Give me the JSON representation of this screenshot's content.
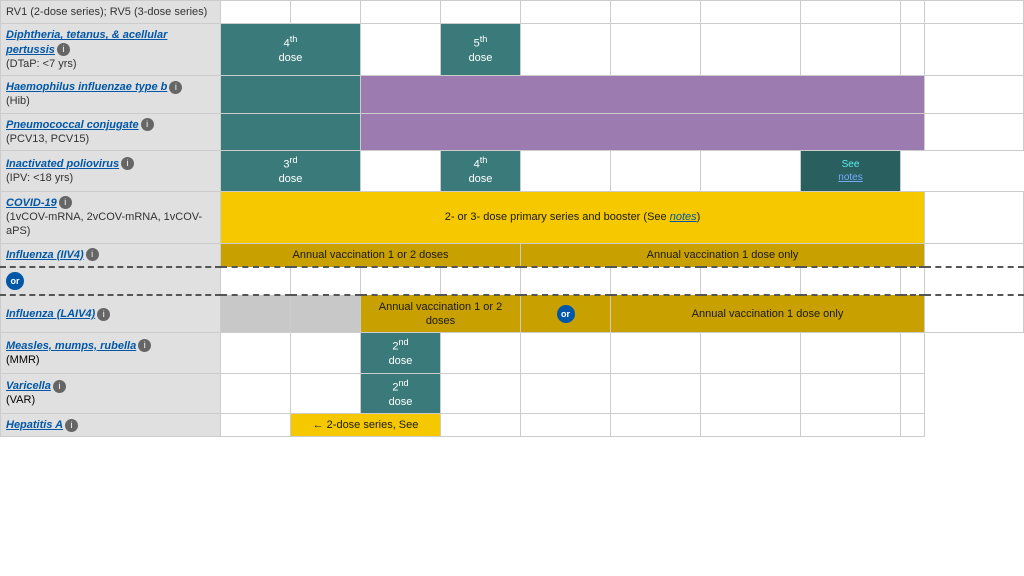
{
  "rows": [
    {
      "id": "rv",
      "name_text": "RV1 (2-dose series); RV5 (3-dose series)",
      "name_link": null,
      "sub": null,
      "cells": [
        {
          "span": 1,
          "class": "gray-light",
          "text": ""
        },
        {
          "span": 1,
          "class": "gray-light",
          "text": ""
        },
        {
          "span": 1,
          "class": "gray-light",
          "text": ""
        },
        {
          "span": 1,
          "class": "",
          "text": ""
        },
        {
          "span": 1,
          "class": "",
          "text": ""
        },
        {
          "span": 1,
          "class": "",
          "text": ""
        },
        {
          "span": 1,
          "class": "",
          "text": ""
        },
        {
          "span": 1,
          "class": "",
          "text": ""
        },
        {
          "span": 1,
          "class": "",
          "text": ""
        }
      ]
    },
    {
      "id": "dtap",
      "name_text": "Diphtheria, tetanus, & acellular pertussis",
      "name_link": true,
      "sub": "(DTaP: <7 yrs)",
      "info": true,
      "cells": [
        {
          "span": 2,
          "class": "teal-dark",
          "text": "←4th dose→",
          "text_color": "white"
        },
        {
          "span": 1,
          "class": "",
          "text": ""
        },
        {
          "span": 1,
          "class": "teal-dark dose-box",
          "text": "5th dose",
          "text_color": "white"
        },
        {
          "span": 1,
          "class": "",
          "text": ""
        },
        {
          "span": 1,
          "class": "",
          "text": ""
        },
        {
          "span": 1,
          "class": "",
          "text": ""
        },
        {
          "span": 1,
          "class": "",
          "text": ""
        },
        {
          "span": 1,
          "class": "",
          "text": ""
        }
      ]
    },
    {
      "id": "hib",
      "name_text": "Haemophilus influenzae type b",
      "name_link": true,
      "sub": "(Hib)",
      "info": true,
      "cells": [
        {
          "span": 2,
          "class": "teal-dark",
          "text": ""
        },
        {
          "span": 6,
          "class": "purple",
          "text": ""
        }
      ]
    },
    {
      "id": "pcv",
      "name_text": "Pneumococcal conjugate",
      "name_link": true,
      "sub": "(PCV13, PCV15)",
      "info": true,
      "cells": [
        {
          "span": 2,
          "class": "teal-dark",
          "text": ""
        },
        {
          "span": 6,
          "class": "purple",
          "text": ""
        }
      ]
    },
    {
      "id": "ipv",
      "name_text": "Inactivated poliovirus",
      "name_link": true,
      "sub": "(IPV: <18 yrs)",
      "info": true,
      "cells": [
        {
          "span": 2,
          "class": "teal-dark",
          "text": "←3rd dose→",
          "text_color": "white"
        },
        {
          "span": 1,
          "class": "",
          "text": ""
        },
        {
          "span": 1,
          "class": "teal-dark dose-box",
          "text": "4th dose",
          "text_color": "white"
        },
        {
          "span": 1,
          "class": "",
          "text": ""
        },
        {
          "span": 1,
          "class": "",
          "text": ""
        },
        {
          "span": 1,
          "class": "",
          "text": ""
        },
        {
          "span": 1,
          "class": "dark-teal",
          "text": "See notes",
          "text_color": "teal-link"
        }
      ]
    },
    {
      "id": "covid",
      "name_text": "COVID-19",
      "name_link": true,
      "sub": "(1vCOV-mRNA, 2vCOV-mRNA, 1vCOV-aPS)",
      "info": true,
      "cells": [
        {
          "span": 8,
          "class": "yellow-cell",
          "text": "2- or 3- dose primary series and booster (See notes)",
          "text_color": "dark"
        }
      ]
    },
    {
      "id": "influenza_iiv4",
      "name_text": "Influenza (IIV4)",
      "name_link": true,
      "sub": null,
      "info": true,
      "cells": [
        {
          "span": 4,
          "class": "yellow-dark",
          "text": "Annual vaccination 1 or 2 doses",
          "text_color": "dark"
        },
        {
          "span": 4,
          "class": "yellow-dark",
          "text": "Annual vaccination 1 dose only",
          "text_color": "dark"
        }
      ]
    },
    {
      "id": "or_row",
      "or": true
    },
    {
      "id": "influenza_laiv4",
      "name_text": "Influenza (LAIV4)",
      "name_link": true,
      "sub": null,
      "info": true,
      "dashed_top": true,
      "cells": [
        {
          "span": 1,
          "class": "gray-light",
          "text": ""
        },
        {
          "span": 1,
          "class": "gray-light",
          "text": ""
        },
        {
          "span": 2,
          "class": "yellow-dark",
          "text": "Annual vaccination 1 or 2 doses",
          "text_color": "dark"
        },
        {
          "span": 1,
          "class": "yellow-dark or-mid",
          "text": "",
          "has_or": true
        },
        {
          "span": 3,
          "class": "yellow-dark",
          "text": "Annual vaccination 1 dose only",
          "text_color": "dark"
        }
      ]
    },
    {
      "id": "mmr",
      "name_text": "Measles, mumps, rubella",
      "name_link": true,
      "sub": "(MMR)",
      "info": true,
      "cells": [
        {
          "span": 1,
          "class": "",
          "text": ""
        },
        {
          "span": 1,
          "class": "",
          "text": ""
        },
        {
          "span": 1,
          "class": "teal-dark dose-box",
          "text": "2nd dose",
          "text_color": "white"
        },
        {
          "span": 5,
          "class": "",
          "text": ""
        }
      ]
    },
    {
      "id": "varicella",
      "name_text": "Varicella",
      "name_link": true,
      "sub": "(VAR)",
      "info": true,
      "cells": [
        {
          "span": 1,
          "class": "",
          "text": ""
        },
        {
          "span": 1,
          "class": "",
          "text": ""
        },
        {
          "span": 1,
          "class": "teal-dark dose-box",
          "text": "2nd dose",
          "text_color": "white"
        },
        {
          "span": 5,
          "class": "",
          "text": ""
        }
      ]
    },
    {
      "id": "hepa",
      "name_text": "Hepatitis A",
      "name_link": true,
      "sub": null,
      "info": true,
      "cells": [
        {
          "span": 1,
          "class": "",
          "text": ""
        },
        {
          "span": 2,
          "class": "yellow-cell",
          "text": "← 2-dose series, See",
          "text_color": "dark"
        },
        {
          "span": 5,
          "class": "",
          "text": ""
        }
      ]
    }
  ],
  "labels": {
    "info_char": "i",
    "or_text": "or",
    "see_notes": "notes",
    "see": "See",
    "notes": "notes"
  }
}
